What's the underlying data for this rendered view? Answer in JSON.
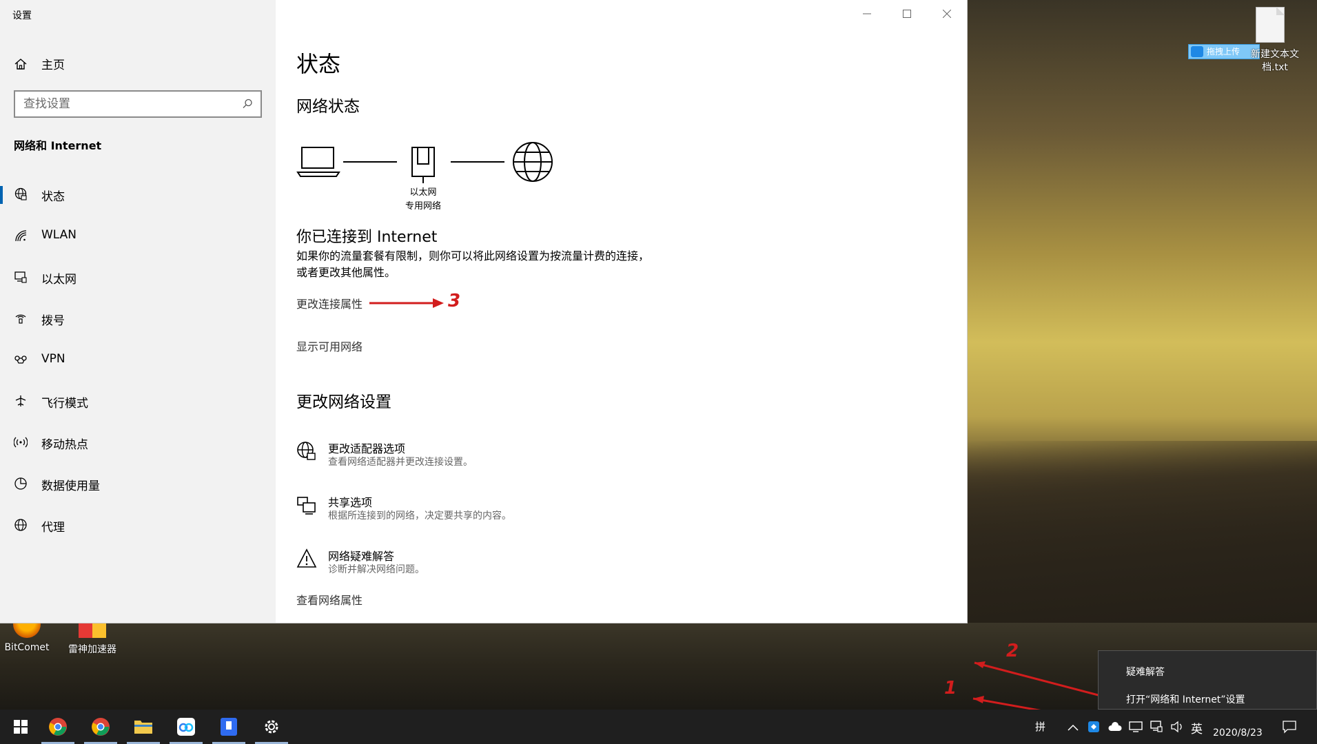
{
  "window": {
    "app_title": "设置",
    "home_label": "主页",
    "search_placeholder": "查找设置",
    "section_title": "网络和 Internet",
    "nav_items": [
      {
        "label": "状态",
        "icon": "globe-network-icon"
      },
      {
        "label": "WLAN",
        "icon": "wifi-icon"
      },
      {
        "label": "以太网",
        "icon": "ethernet-icon"
      },
      {
        "label": "拨号",
        "icon": "dialup-icon"
      },
      {
        "label": "VPN",
        "icon": "vpn-icon"
      },
      {
        "label": "飞行模式",
        "icon": "airplane-icon"
      },
      {
        "label": "移动热点",
        "icon": "hotspot-icon"
      },
      {
        "label": "数据使用量",
        "icon": "pie-chart-icon"
      },
      {
        "label": "代理",
        "icon": "globe-icon"
      }
    ]
  },
  "content": {
    "page_title": "状态",
    "network_status_title": "网络状态",
    "diagram_label_1": "以太网",
    "diagram_label_2": "专用网络",
    "connected_title": "你已连接到 Internet",
    "connected_desc": "如果你的流量套餐有限制，则你可以将此网络设置为按流量计费的连接，或者更改其他属性。",
    "link_change_props": "更改连接属性",
    "link_show_networks": "显示可用网络",
    "change_settings_title": "更改网络设置",
    "options": [
      {
        "title": "更改适配器选项",
        "desc": "查看网络适配器并更改连接设置。",
        "icon": "adapter-globe-icon"
      },
      {
        "title": "共享选项",
        "desc": "根据所连接到的网络，决定要共享的内容。",
        "icon": "sharing-icon"
      },
      {
        "title": "网络疑难解答",
        "desc": "诊断并解决网络问题。",
        "icon": "warning-icon"
      }
    ],
    "link_view_props": "查看网络属性"
  },
  "annotations": {
    "n1": "1",
    "n2": "2",
    "n3": "3"
  },
  "desktop": {
    "file_label": "新建文本文档.txt",
    "upload_badge": "拖拽上传",
    "icons": [
      {
        "label": "BitComet"
      },
      {
        "label": "雷神加速器"
      }
    ]
  },
  "popup": {
    "item1": "疑难解答",
    "item2": "打开“网络和 Internet”设置"
  },
  "taskbar": {
    "ime_mode": "拼",
    "lang": "英",
    "date": "2020/8/23"
  },
  "colors": {
    "accent": "#0063b1",
    "annotation_red": "#d21d1d",
    "taskbar_bg": "#1f1f1f"
  }
}
